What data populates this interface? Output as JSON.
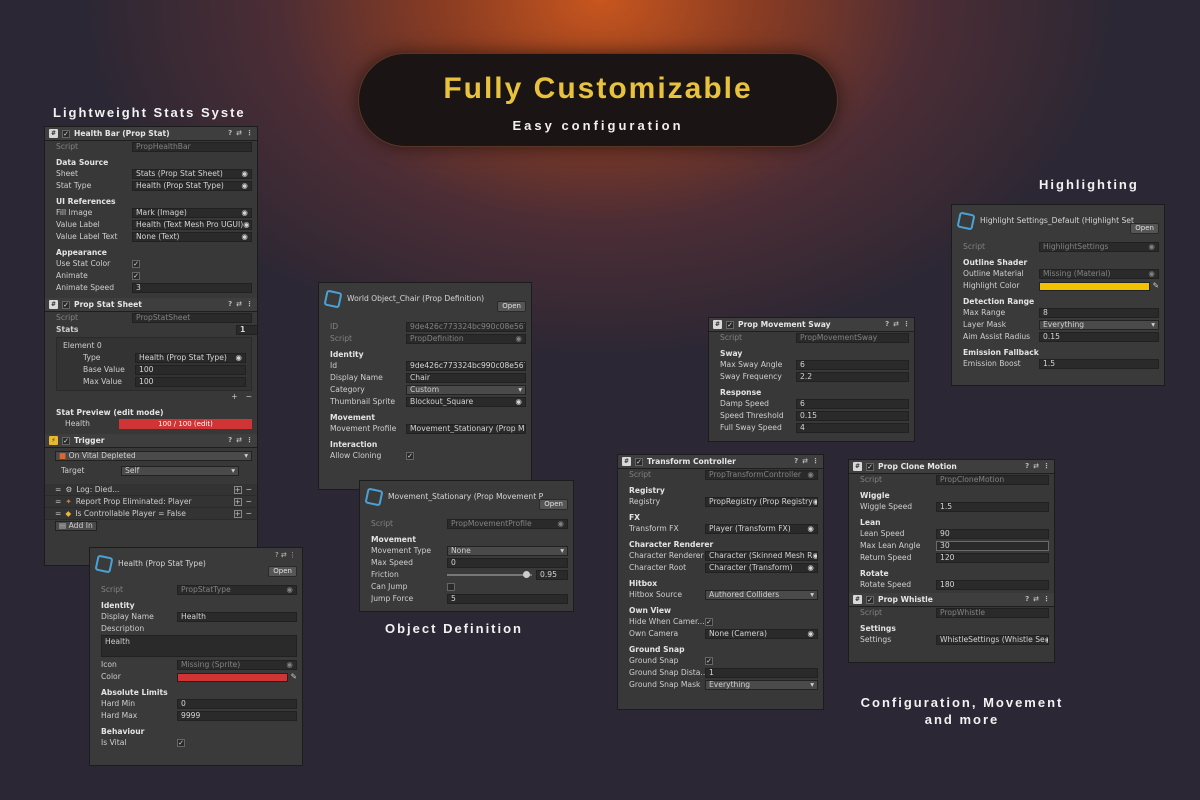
{
  "banner": {
    "title": "Fully Customizable",
    "subtitle": "Easy configuration"
  },
  "captions": {
    "stats": "Lightweight Stats Syste",
    "highlighting": "Highlighting",
    "object_definition": "Object Definition",
    "config_line1": "Configuration, Movement",
    "config_line2": "and more"
  },
  "colors": {
    "accent_yellow": "#e8c23c",
    "health_bar": "#d13434",
    "highlight_color": "#f2c200",
    "cube_icon": "#4aa3d8"
  },
  "health_bar": {
    "title": "Health Bar (Prop Stat)",
    "script_label": "Script",
    "script": "PropHealthBar",
    "data_source": "Data Source",
    "sheet_label": "Sheet",
    "sheet": "Stats (Prop Stat Sheet)",
    "stat_type_label": "Stat Type",
    "stat_type": "Health (Prop Stat Type)",
    "ui_refs": "UI References",
    "fill_image_label": "Fill Image",
    "fill_image": "Mark (Image)",
    "value_label_label": "Value Label",
    "value_label": "Health (Text Mesh Pro UGUI)",
    "value_label_text_label": "Value Label Text",
    "value_label_text": "None (Text)",
    "appearance": "Appearance",
    "use_stat_color": "Use Stat Color",
    "animate": "Animate",
    "animate_speed_label": "Animate Speed",
    "animate_speed": "3"
  },
  "stat_sheet": {
    "title": "Prop Stat Sheet",
    "script_label": "Script",
    "script": "PropStatSheet",
    "stats_label": "Stats",
    "stats_count": "1",
    "element": "Element 0",
    "type_label": "Type",
    "type": "Health (Prop Stat Type)",
    "base_label": "Base Value",
    "base": "100",
    "max_label": "Max Value",
    "max": "100",
    "preview": "Stat Preview (edit mode)",
    "health_label": "Health",
    "health_bar": "100 / 100  (edit)"
  },
  "trigger": {
    "title": "Trigger",
    "event": "On Vital Depleted",
    "target_label": "Target",
    "target": "Self",
    "actions": [
      "Log: Died...",
      "Report Prop Eliminated: Player",
      "Is Controllable Player = False"
    ],
    "add_label": "Add In"
  },
  "stat_type": {
    "title": "Health (Prop Stat Type)",
    "open": "Open",
    "script_label": "Script",
    "script": "PropStatType",
    "identity": "Identity",
    "display_name_label": "Display Name",
    "display_name": "Health",
    "description_label": "Description",
    "description": "Health",
    "icon_label": "Icon",
    "icon": "Missing (Sprite)",
    "color_label": "Color",
    "abs_limits": "Absolute Limits",
    "hard_min_label": "Hard Min",
    "hard_min": "0",
    "hard_max_label": "Hard Max",
    "hard_max": "9999",
    "behaviour": "Behaviour",
    "is_vital": "Is Vital"
  },
  "world_object": {
    "title": "World Object_Chair (Prop Definition)",
    "open": "Open",
    "id_label": "ID",
    "id": "9de426c773324bc990c08e567535",
    "script_label": "Script",
    "script": "PropDefinition",
    "identity": "Identity",
    "id2_label": "Id",
    "id2": "9de426c773324bc990c08e567535",
    "display_name_label": "Display Name",
    "display_name": "Chair",
    "category_label": "Category",
    "category": "Custom",
    "thumb_label": "Thumbnail Sprite",
    "thumb": "Blockout_Square",
    "movement": "Movement",
    "movement_profile_label": "Movement Profile",
    "movement_profile": "Movement_Stationary (Prop M",
    "interaction": "Interaction",
    "allow_cloning": "Allow Cloning"
  },
  "movement_stationary": {
    "title": "Movement_Stationary (Prop Movement P",
    "open": "Open",
    "script_label": "Script",
    "script": "PropMovementProfile",
    "movement": "Movement",
    "type_label": "Movement Type",
    "type": "None",
    "max_speed_label": "Max Speed",
    "max_speed": "0",
    "friction_label": "Friction",
    "friction": "0.95",
    "can_jump_label": "Can Jump",
    "jump_force_label": "Jump Force",
    "jump_force": "5"
  },
  "sway": {
    "title": "Prop Movement Sway",
    "script_label": "Script",
    "script": "PropMovementSway",
    "sway": "Sway",
    "max_angle_label": "Max Sway Angle",
    "max_angle": "6",
    "freq_label": "Sway Frequency",
    "freq": "2.2",
    "response": "Response",
    "damp_label": "Damp Speed",
    "damp": "6",
    "threshold_label": "Speed Threshold",
    "threshold": "0.15",
    "full_label": "Full Sway Speed",
    "full": "4"
  },
  "transform": {
    "title": "Transform Controller",
    "script_label": "Script",
    "script": "PropTransformController",
    "registry": "Registry",
    "registry_label": "Registry",
    "registry_val": "PropRegistry (Prop Registry",
    "fx": "FX",
    "tfx_label": "Transform FX",
    "tfx": "Player (Transform FX)",
    "char_renderer": "Character Renderer",
    "cr_label": "Character Renderer",
    "cr": "Character (Skinned Mesh R",
    "croot_label": "Character Root",
    "croot": "Character (Transform)",
    "hitbox": "Hitbox",
    "hitbox_label": "Hitbox Source",
    "hitbox_val": "Authored Colliders",
    "own_view": "Own View",
    "hide_label": "Hide When Camer...",
    "own_cam_label": "Own Camera",
    "own_cam": "None (Camera)",
    "ground_snap": "Ground Snap",
    "gs_label": "Ground Snap",
    "gsd_label": "Ground Snap Dista...",
    "gsd": "1",
    "gsm_label": "Ground Snap Mask",
    "gsm": "Everything"
  },
  "highlight": {
    "title": "Highlight Settings_Default (Highlight Set",
    "open": "Open",
    "script_label": "Script",
    "script": "HighlightSettings",
    "outline": "Outline Shader",
    "mat_label": "Outline Material",
    "mat": "Missing (Material)",
    "color_label": "Highlight Color",
    "detection": "Detection Range",
    "max_range_label": "Max Range",
    "max_range": "8",
    "mask_label": "Layer Mask",
    "mask": "Everything",
    "aim_label": "Aim Assist Radius",
    "aim": "0.15",
    "emission": "Emission Fallback",
    "boost_label": "Emission Boost",
    "boost": "1.5"
  },
  "clone": {
    "title": "Prop Clone Motion",
    "script_label": "Script",
    "script": "PropCloneMotion",
    "wiggle": "Wiggle",
    "wiggle_label": "Wiggle Speed",
    "wiggle_val": "1.5",
    "lean": "Lean",
    "lean_speed_label": "Lean Speed",
    "lean_speed": "90",
    "max_lean_label": "Max Lean Angle",
    "max_lean": "30",
    "return_label": "Return Speed",
    "return_val": "120",
    "rotate": "Rotate",
    "rot_label": "Rotate Speed",
    "rot": "180"
  },
  "whistle": {
    "title": "Prop Whistle",
    "script_label": "Script",
    "script": "PropWhistle",
    "settings": "Settings",
    "settings_label": "Settings",
    "settings_val": "WhistleSettings (Whistle Se"
  }
}
